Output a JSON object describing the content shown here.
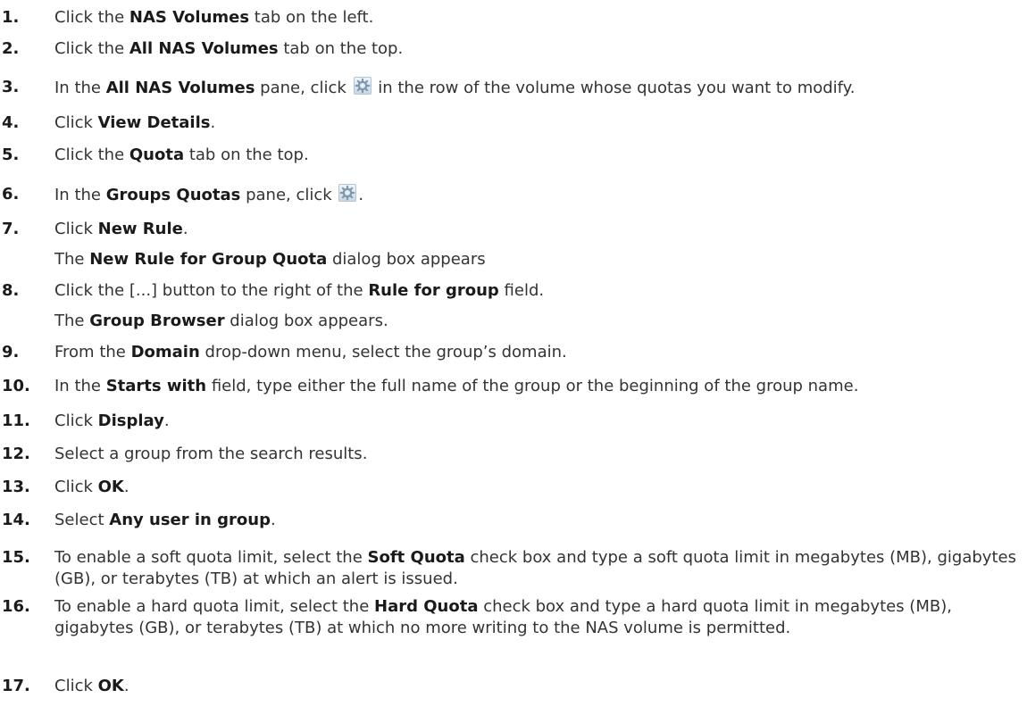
{
  "steps": [
    {
      "n": "1.",
      "parts": [
        {
          "t": "Click the "
        },
        {
          "b": "NAS Volumes"
        },
        {
          "t": " tab on the left."
        }
      ]
    },
    {
      "n": "2.",
      "parts": [
        {
          "t": "Click the "
        },
        {
          "b": "All NAS Volumes"
        },
        {
          "t": " tab on the top."
        }
      ]
    },
    {
      "n": "3.",
      "parts": [
        {
          "t": "In the "
        },
        {
          "b": "All NAS Volumes"
        },
        {
          "t": " pane, click "
        },
        {
          "icon": "gear-icon"
        },
        {
          "t": " in the row of the volume whose quotas you want to modify."
        }
      ]
    },
    {
      "n": "4.",
      "parts": [
        {
          "t": "Click "
        },
        {
          "b": "View Details"
        },
        {
          "t": "."
        }
      ]
    },
    {
      "n": "5.",
      "parts": [
        {
          "t": "Click the "
        },
        {
          "b": "Quota"
        },
        {
          "t": " tab on the top."
        }
      ]
    },
    {
      "n": "6.",
      "parts": [
        {
          "t": "In the "
        },
        {
          "b": "Groups Quotas"
        },
        {
          "t": " pane, click "
        },
        {
          "icon": "gear-icon"
        },
        {
          "t": "."
        }
      ]
    },
    {
      "n": "7.",
      "parts": [
        {
          "t": "Click "
        },
        {
          "b": "New Rule"
        },
        {
          "t": "."
        }
      ],
      "note": [
        {
          "t": "The "
        },
        {
          "b": "New Rule for Group Quota"
        },
        {
          "t": " dialog box appears"
        }
      ]
    },
    {
      "n": "8.",
      "parts": [
        {
          "t": "Click the [...] button to the right of the "
        },
        {
          "b": "Rule for group"
        },
        {
          "t": " field."
        }
      ],
      "note": [
        {
          "t": "The "
        },
        {
          "b": "Group Browser"
        },
        {
          "t": " dialog box appears."
        }
      ]
    },
    {
      "n": "9.",
      "parts": [
        {
          "t": "From the "
        },
        {
          "b": "Domain"
        },
        {
          "t": " drop-down menu, select the group’s domain."
        }
      ]
    },
    {
      "n": "10.",
      "parts": [
        {
          "t": "In the "
        },
        {
          "b": "Starts with"
        },
        {
          "t": " field, type either the full name of the group or the beginning of the group name."
        }
      ]
    },
    {
      "n": "11.",
      "parts": [
        {
          "t": "Click "
        },
        {
          "b": "Display"
        },
        {
          "t": "."
        }
      ]
    },
    {
      "n": "12.",
      "parts": [
        {
          "t": "Select a group from the search results."
        }
      ]
    },
    {
      "n": "13.",
      "parts": [
        {
          "t": "Click "
        },
        {
          "b": "OK"
        },
        {
          "t": "."
        }
      ]
    },
    {
      "n": "14.",
      "parts": [
        {
          "t": "Select "
        },
        {
          "b": "Any user in group"
        },
        {
          "t": "."
        }
      ]
    },
    {
      "n": "15.",
      "parts": [
        {
          "t": "To enable a soft quota limit, select the "
        },
        {
          "b": "Soft Quota"
        },
        {
          "t": " check box and type a soft quota limit in megabytes (MB), gigabytes (GB), or terabytes (TB) at which an alert is issued."
        }
      ]
    },
    {
      "n": "16.",
      "parts": [
        {
          "t": "To enable a hard quota limit, select the "
        },
        {
          "b": "Hard Quota"
        },
        {
          "t": " check box and type a hard quota limit in megabytes (MB), gigabytes (GB), or terabytes (TB) at which no more writing to the NAS volume is permitted."
        }
      ]
    },
    {
      "n": "17.",
      "parts": [
        {
          "t": "Click "
        },
        {
          "b": "OK"
        },
        {
          "t": "."
        }
      ]
    }
  ],
  "colors": {
    "text": "#333333",
    "bold": "#1a1a1a",
    "gear_bg": "#c9d8e6"
  }
}
